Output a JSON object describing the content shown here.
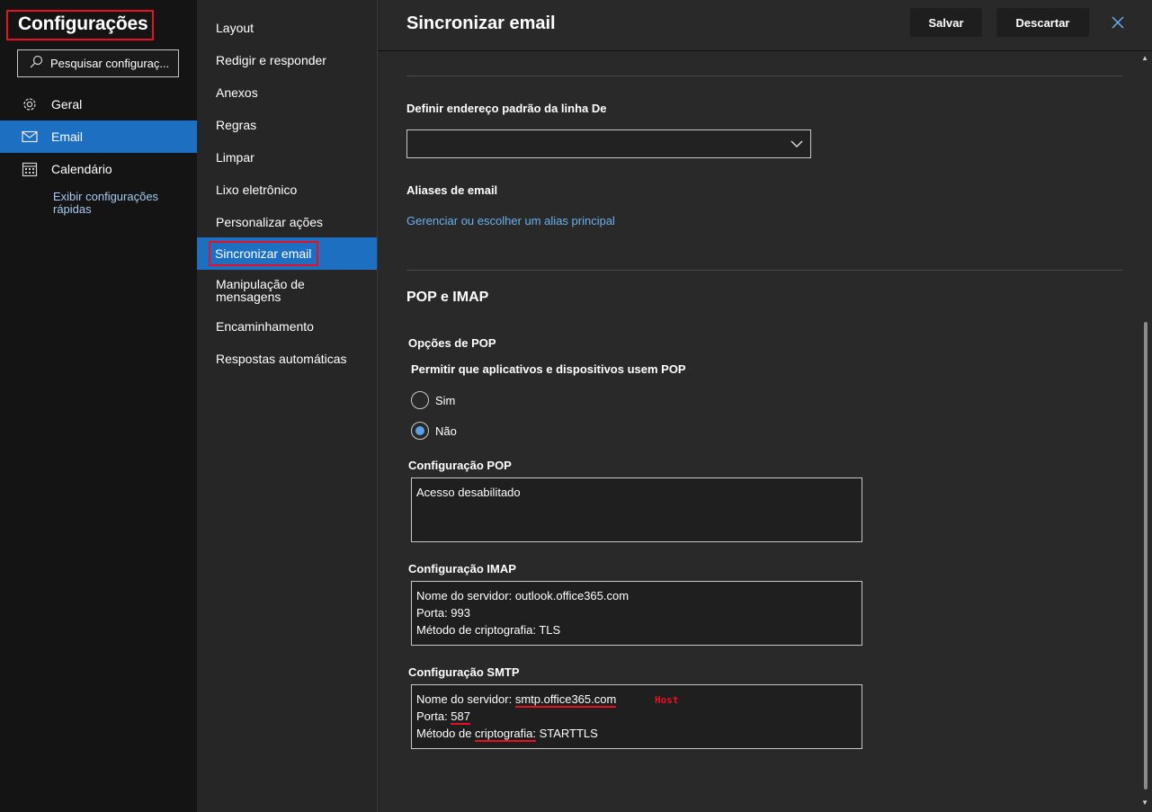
{
  "left": {
    "title": "Configurações",
    "search_placeholder": "Pesquisar configuraç...",
    "items": [
      {
        "label": "Geral"
      },
      {
        "label": "Email"
      },
      {
        "label": "Calendário"
      }
    ],
    "quick_settings": "Exibir configurações rápidas"
  },
  "mid": {
    "items": [
      {
        "label": "Layout"
      },
      {
        "label": "Redigir e responder"
      },
      {
        "label": "Anexos"
      },
      {
        "label": "Regras"
      },
      {
        "label": "Limpar"
      },
      {
        "label": "Lixo eletrônico"
      },
      {
        "label": "Personalizar ações"
      },
      {
        "label": "Sincronizar email"
      },
      {
        "label": "Manipulação de mensagens"
      },
      {
        "label": "Encaminhamento"
      },
      {
        "label": "Respostas automáticas"
      }
    ]
  },
  "header": {
    "title": "Sincronizar email",
    "save_label": "Salvar",
    "discard_label": "Descartar"
  },
  "content": {
    "from_label": "Definir endereço padrão da linha De",
    "from_value": "",
    "aliases_label": "Aliases de email",
    "aliases_link": "Gerenciar ou escolher um alias principal",
    "section_title": "POP e IMAP",
    "pop_options": "Opções de POP",
    "pop_question": "Permitir que aplicativos e dispositivos usem POP",
    "radio_yes": "Sim",
    "radio_no": "Não",
    "pop_cfg_label": "Configuração POP",
    "pop_cfg_text": "Acesso desabilitado",
    "imap_cfg_label": "Configuração IMAP",
    "imap_server": "Nome do servidor: outlook.office365.com",
    "imap_port": "Porta: 993",
    "imap_crypto": "Método de criptografia: TLS",
    "smtp_cfg_label": "Configuração SMTP",
    "smtp_server_label": "Nome do servidor: ",
    "smtp_server_value": "smtp.office365.com",
    "smtp_port_label": "Porta: ",
    "smtp_port_value": "587",
    "smtp_crypto_a": "Método de ",
    "smtp_crypto_b": "criptografia:",
    "smtp_crypto_c": " STARTTLS",
    "annotation_host": "Host"
  }
}
